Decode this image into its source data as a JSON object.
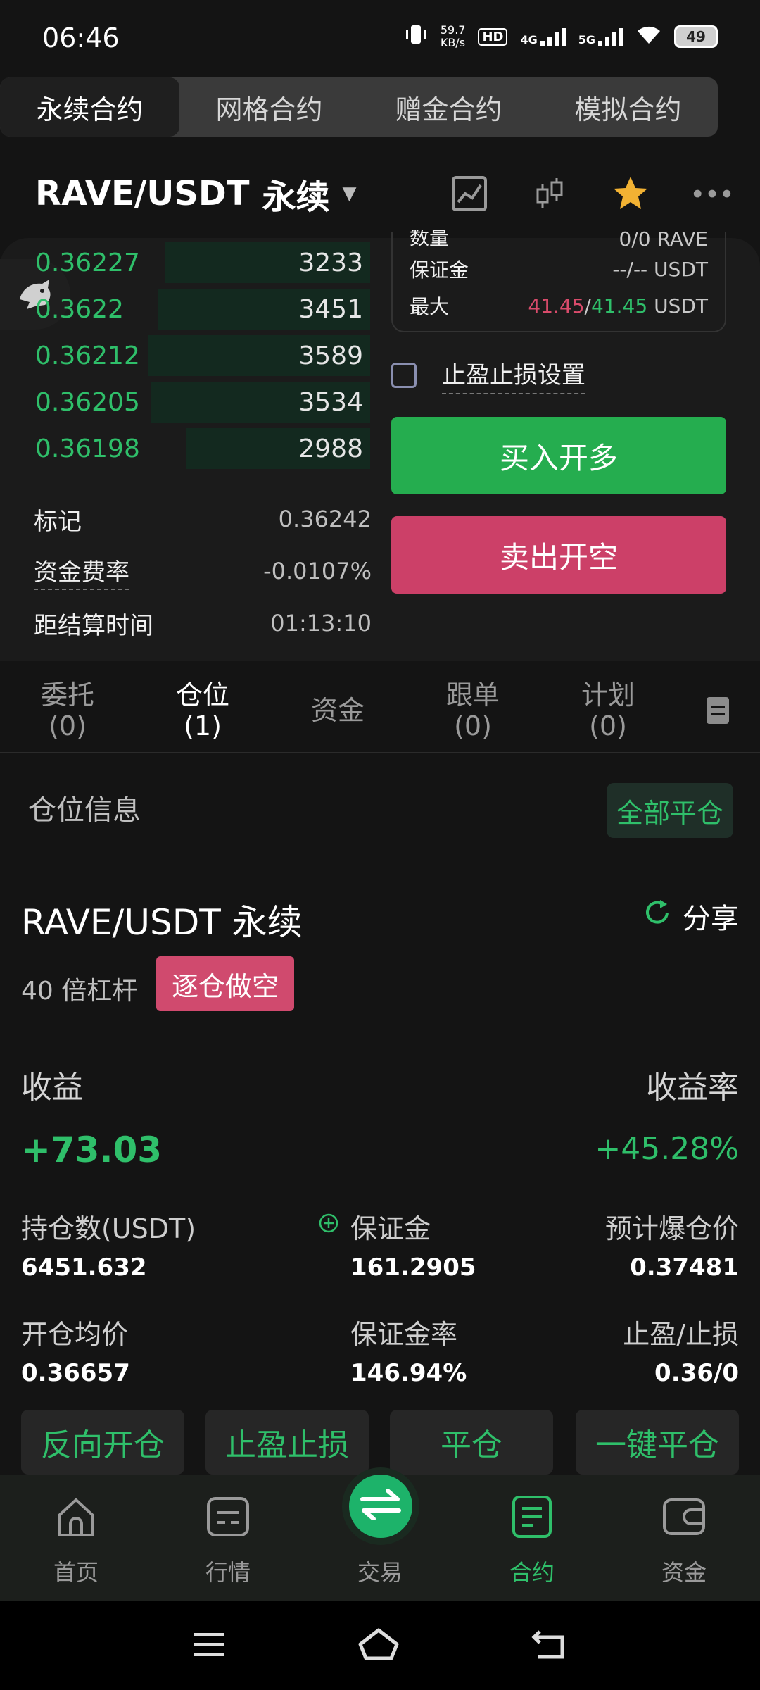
{
  "status_bar": {
    "time": "06:46",
    "net_speed": "59.7",
    "net_speed_unit": "KB/s",
    "hd": "HD",
    "signal_4g": "4G",
    "signal_5g": "5G",
    "battery": "49"
  },
  "contract_tabs": [
    "永续合约",
    "网格合约",
    "赠金合约",
    "模拟合约"
  ],
  "header": {
    "pair": "RAVE/USDT",
    "suffix": "永续"
  },
  "orderbook": {
    "rows": [
      {
        "price": "0.36227",
        "qty": "3233",
        "depth": 0.6
      },
      {
        "price": "0.3622",
        "qty": "3451",
        "depth": 0.62
      },
      {
        "price": "0.36212",
        "qty": "3589",
        "depth": 0.65
      },
      {
        "price": "0.36205",
        "qty": "3534",
        "depth": 0.64
      },
      {
        "price": "0.36198",
        "qty": "2988",
        "depth": 0.54
      }
    ]
  },
  "stats": {
    "mark_label": "标记",
    "mark_value": "0.36242",
    "funding_label": "资金费率",
    "funding_value": "-0.0107%",
    "settle_label": "距结算时间",
    "settle_value": "01:13:10"
  },
  "order_info": {
    "qty_label": "数量",
    "qty_value": "0/0 RAVE",
    "margin_label": "保证金",
    "margin_value": "--/-- USDT",
    "max_label": "最大",
    "max_buy": "41.45",
    "max_sep": "/",
    "max_sell": "41.45",
    "max_unit": "USDT"
  },
  "form": {
    "tp_sl_label": "止盈止损设置",
    "buy_label": "买入开多",
    "sell_label": "卖出开空"
  },
  "order_tabs": [
    {
      "label": "委托",
      "count": "(0)"
    },
    {
      "label": "仓位",
      "count": "(1)"
    },
    {
      "label": "资金",
      "count": ""
    },
    {
      "label": "跟单",
      "count": "(0)"
    },
    {
      "label": "计划",
      "count": "(0)"
    }
  ],
  "position": {
    "section_title": "仓位信息",
    "close_all": "全部平仓",
    "pair": "RAVE/USDT 永续",
    "share": "分享",
    "leverage": "40 倍杠杆",
    "mode": "逐仓做空",
    "pnl_label": "收益",
    "pnl_value": "+73.03",
    "roe_label": "收益率",
    "roe_value": "+45.28%",
    "size_label": "持仓数(USDT)",
    "size_value": "6451.632",
    "margin_label": "保证金",
    "margin_value": "161.2905",
    "liq_label": "预计爆仓价",
    "liq_value": "0.37481",
    "entry_label": "开仓均价",
    "entry_value": "0.36657",
    "margin_ratio_label": "保证金率",
    "margin_ratio_value": "146.94%",
    "tpsl_label": "止盈/止损",
    "tpsl_value": "0.36/0"
  },
  "actions": [
    "反向开仓",
    "止盈止损",
    "平仓",
    "一键平仓"
  ],
  "bottom_nav": [
    {
      "label": "首页",
      "icon": "home-icon"
    },
    {
      "label": "行情",
      "icon": "market-icon"
    },
    {
      "label": "交易",
      "icon": "trade-icon"
    },
    {
      "label": "合约",
      "icon": "contract-icon"
    },
    {
      "label": "资金",
      "icon": "wallet-icon"
    }
  ],
  "colors": {
    "green": "#2fbf6a",
    "red": "#d94b6b",
    "buy": "#25ad4f",
    "sell": "#cc4068"
  }
}
